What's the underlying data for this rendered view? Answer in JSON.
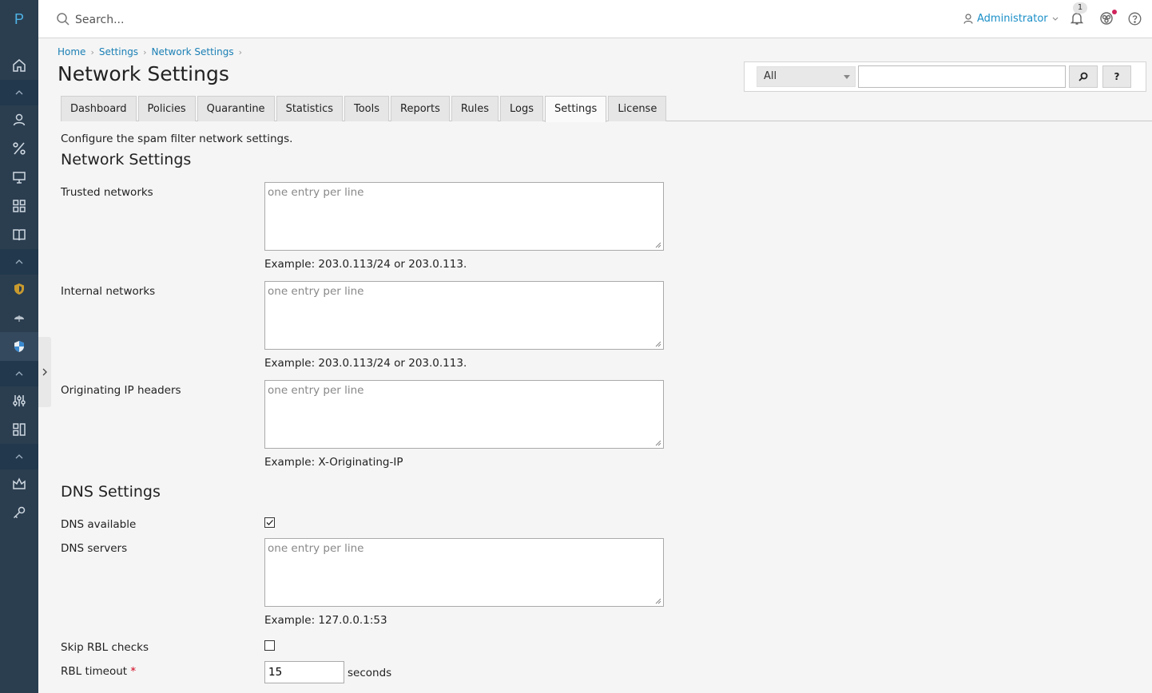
{
  "nav": {
    "logo": "P"
  },
  "topbar": {
    "search_placeholder": "Search...",
    "user": "Administrator",
    "notifications_count": "1"
  },
  "breadcrumb": [
    "Home",
    "Settings",
    "Network Settings"
  ],
  "page_title": "Network Settings",
  "filter": {
    "selected": "All",
    "search_button": "⌕",
    "help_button": "?"
  },
  "tabs": [
    "Dashboard",
    "Policies",
    "Quarantine",
    "Statistics",
    "Tools",
    "Reports",
    "Rules",
    "Logs",
    "Settings",
    "License"
  ],
  "active_tab": "Settings",
  "description": "Configure the spam filter network settings.",
  "network_section": {
    "title": "Network Settings",
    "trusted": {
      "label": "Trusted networks",
      "placeholder": "one entry per line",
      "example": "Example: 203.0.113/24 or 203.0.113."
    },
    "internal": {
      "label": "Internal networks",
      "placeholder": "one entry per line",
      "example": "Example: 203.0.113/24 or 203.0.113."
    },
    "originating": {
      "label": "Originating IP headers",
      "placeholder": "one entry per line",
      "example": "Example: X-Originating-IP"
    }
  },
  "dns_section": {
    "title": "DNS Settings",
    "dns_available": {
      "label": "DNS available",
      "checked": true
    },
    "dns_servers": {
      "label": "DNS servers",
      "placeholder": "one entry per line",
      "example": "Example: 127.0.0.1:53"
    },
    "skip_rbl": {
      "label": "Skip RBL checks",
      "checked": false
    },
    "rbl_timeout": {
      "label": "RBL timeout",
      "required_mark": "*",
      "value": "15",
      "unit": "seconds"
    }
  },
  "colors": {
    "nav_bg": "#2b3e50",
    "accent": "#1a8fc7",
    "link": "#1a7fb5",
    "required": "#d0021b"
  }
}
